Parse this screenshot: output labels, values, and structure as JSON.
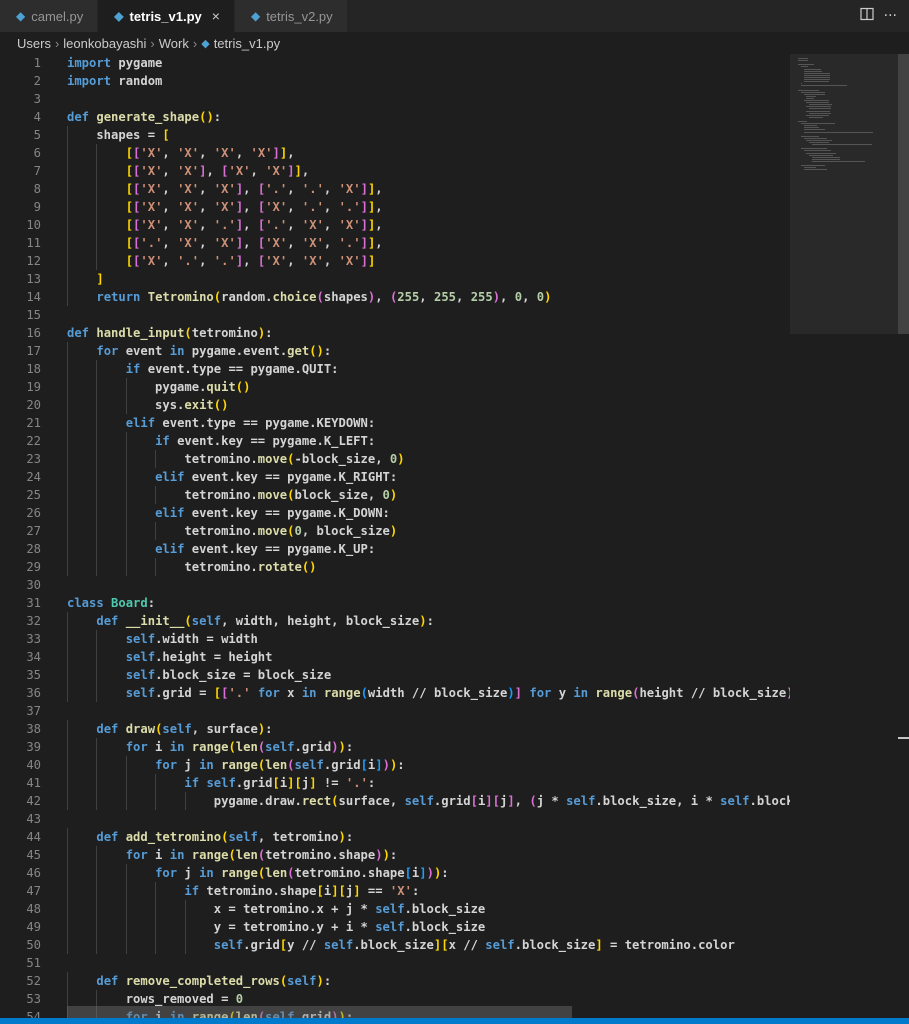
{
  "tabs": [
    {
      "label": "camel.py",
      "active": false
    },
    {
      "label": "tetris_v1.py",
      "active": true
    },
    {
      "label": "tetris_v2.py",
      "active": false
    }
  ],
  "tab_close_symbol": "×",
  "tab_actions": {
    "split_icon": "split-editor-icon",
    "more_label": "···"
  },
  "breadcrumb": [
    "Users",
    "leonkobayashi",
    "Work",
    "tetris_v1.py"
  ],
  "colors": {
    "keyword": "#569cd6",
    "control": "#c586c0",
    "function": "#dcdcaa",
    "string": "#ce9178",
    "number": "#b5cea8",
    "class": "#4ec9b0",
    "background": "#1e1e1e",
    "status_bar": "#007acc"
  },
  "code_lines": [
    "import pygame",
    "import random",
    "",
    "def generate_shape():",
    "    shapes = [",
    "        [['X', 'X', 'X', 'X']],",
    "        [['X', 'X'], ['X', 'X']],",
    "        [['X', 'X', 'X'], ['.', '.', 'X']],",
    "        [['X', 'X', 'X'], ['X', '.', '.']],",
    "        [['X', 'X', '.'], ['.', 'X', 'X']],",
    "        [['.', 'X', 'X'], ['X', 'X', '.']],",
    "        [['X', '.', '.'], ['X', 'X', 'X']]",
    "    ]",
    "    return Tetromino(random.choice(shapes), (255, 255, 255), 0, 0)",
    "",
    "def handle_input(tetromino):",
    "    for event in pygame.event.get():",
    "        if event.type == pygame.QUIT:",
    "            pygame.quit()",
    "            sys.exit()",
    "        elif event.type == pygame.KEYDOWN:",
    "            if event.key == pygame.K_LEFT:",
    "                tetromino.move(-block_size, 0)",
    "            elif event.key == pygame.K_RIGHT:",
    "                tetromino.move(block_size, 0)",
    "            elif event.key == pygame.K_DOWN:",
    "                tetromino.move(0, block_size)",
    "            elif event.key == pygame.K_UP:",
    "                tetromino.rotate()",
    "",
    "class Board:",
    "    def __init__(self, width, height, block_size):",
    "        self.width = width",
    "        self.height = height",
    "        self.block_size = block_size",
    "        self.grid = [['.' for x in range(width // block_size)] for y in range(height // block_size)]",
    "",
    "    def draw(self, surface):",
    "        for i in range(len(self.grid)):",
    "            for j in range(len(self.grid[i])):",
    "                if self.grid[i][j] != '.':",
    "                    pygame.draw.rect(surface, self.grid[i][j], (j * self.block_size, i * self.block_",
    "",
    "    def add_tetromino(self, tetromino):",
    "        for i in range(len(tetromino.shape)):",
    "            for j in range(len(tetromino.shape[i])):",
    "                if tetromino.shape[i][j] == 'X':",
    "                    x = tetromino.x + j * self.block_size",
    "                    y = tetromino.y + i * self.block_size",
    "                    self.grid[y // self.block_size][x // self.block_size] = tetromino.color",
    "",
    "    def remove_completed_rows(self):",
    "        rows_removed = 0",
    "        for i in range(len(self.grid)):"
  ]
}
